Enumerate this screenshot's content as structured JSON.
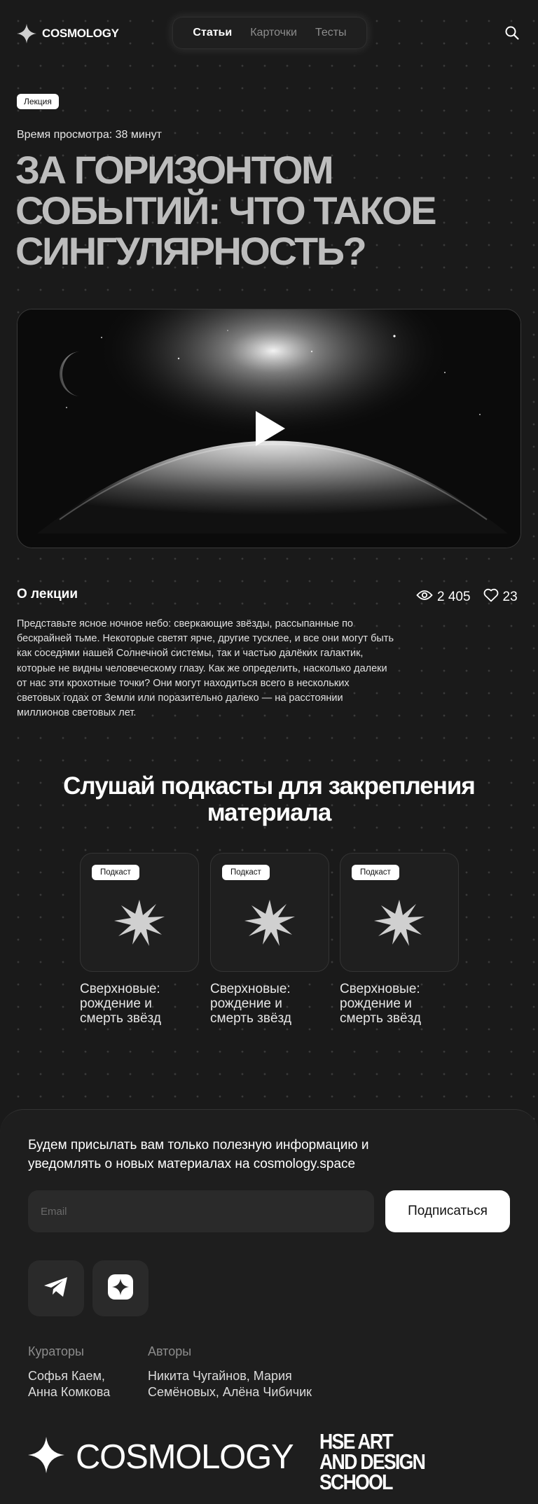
{
  "header": {
    "logo": "COSMOLOGY",
    "nav": [
      "Статьи",
      "Карточки",
      "Тесты"
    ]
  },
  "lecture": {
    "tag": "Лекция",
    "duration": "Время просмотра: 38 минут",
    "title": "За горизонтом событий: что такое сингулярность?"
  },
  "about": {
    "heading": "О лекции",
    "views": "2 405",
    "likes": "23",
    "text": "Представьте ясное ночное небо: сверкающие звёзды, рассыпанные по бескрайней тьме. Некоторые светят ярче, другие тусклее, и все они могут быть как соседями нашей Солнечной системы, так и частью далёких галактик, которые не видны человеческому глазу. Как же определить, насколько далеки от нас эти крохотные точки? Они могут находиться всего в нескольких световых годах от Земли или поразительно далеко — на расстоянии миллионов световых лет."
  },
  "podcasts": {
    "heading": "Слушай подкасты для закрепления материала",
    "items": [
      {
        "badge": "Подкаст",
        "title": "Сверхновые: рождение и смерть звёзд"
      },
      {
        "badge": "Подкаст",
        "title": "Сверхновые: рождение и смерть звёзд"
      },
      {
        "badge": "Подкаст",
        "title": "Сверхновые: рождение и смерть звёзд"
      }
    ]
  },
  "footer": {
    "subscribe_text": "Будем присылать вам только полезную информацию и уведомлять о новых материалах на cosmology.space",
    "email_placeholder": "Email",
    "subscribe_button": "Подписаться",
    "curators_label": "Кураторы",
    "curators": "Софья Каем, Анна Комкова",
    "authors_label": "Авторы",
    "authors": "Никита Чугайнов, Мария Семёновых, Алёна Чибичик",
    "logo": "COSMOLOGY",
    "school": "HSE ART AND DESIGN SCHOOL"
  }
}
